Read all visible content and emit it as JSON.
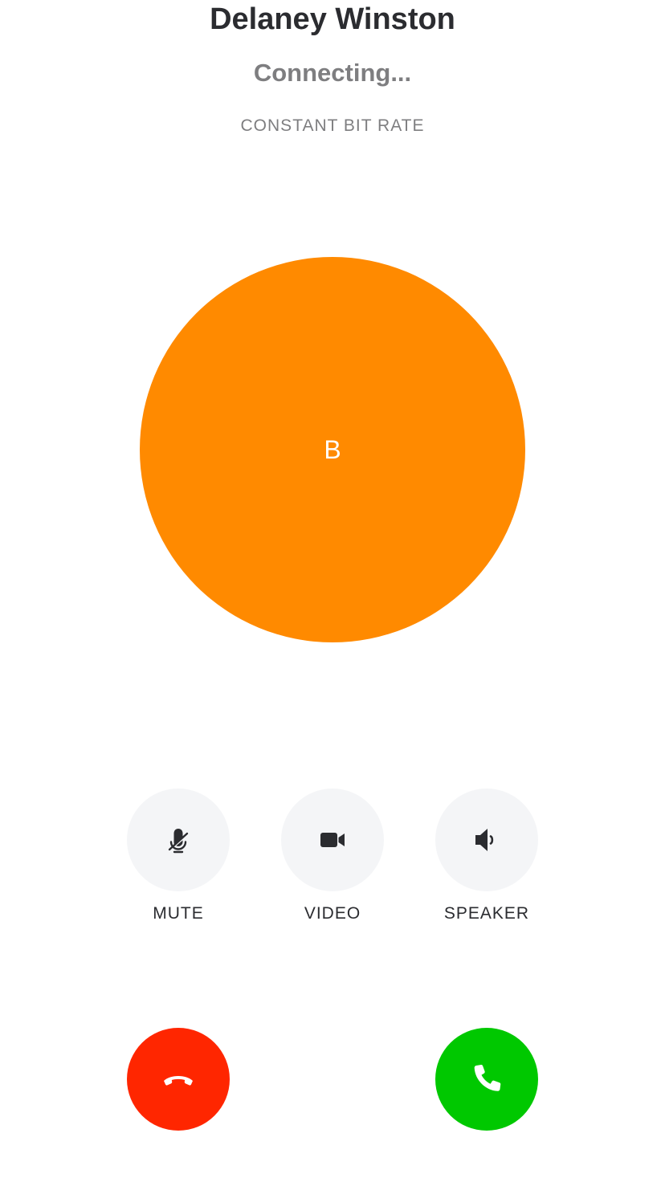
{
  "call": {
    "caller_name": "Delaney Winston",
    "status": "Connecting...",
    "mode": "CONSTANT BIT RATE"
  },
  "avatar": {
    "initial": "B",
    "color": "#ff8a00"
  },
  "controls": {
    "mute": {
      "label": "MUTE",
      "icon": "mic-off-icon"
    },
    "video": {
      "label": "VIDEO",
      "icon": "video-camera-icon"
    },
    "speaker": {
      "label": "SPEAKER",
      "icon": "speaker-icon"
    }
  },
  "actions": {
    "decline": {
      "icon": "hang-up-icon",
      "color": "#ff2600"
    },
    "accept": {
      "icon": "phone-icon",
      "color": "#00c800"
    }
  }
}
